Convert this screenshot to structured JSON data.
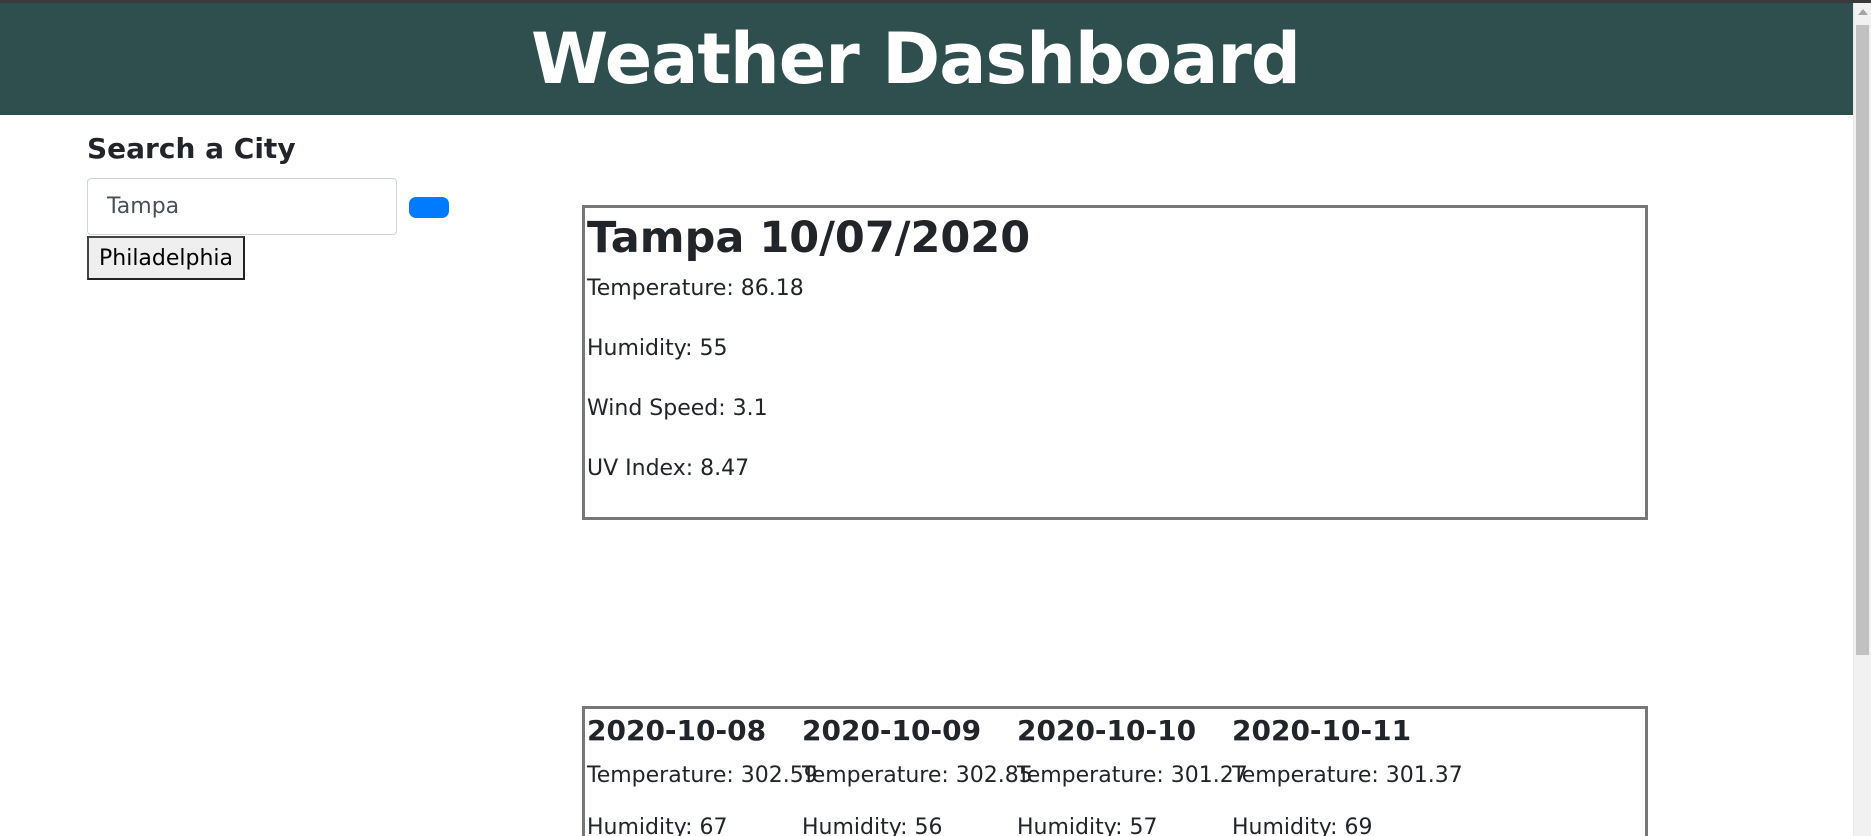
{
  "header": {
    "title": "Weather Dashboard"
  },
  "search": {
    "heading": "Search a City",
    "input_value": "Tampa",
    "button_label": "",
    "button_color": "#007bff",
    "history": [
      "Philadelphia"
    ]
  },
  "current": {
    "title": "Tampa 10/07/2020",
    "temperature": "Temperature: 86.18",
    "humidity": "Humidity: 55",
    "wind_speed": "Wind Speed: 3.1",
    "uv_index": "UV Index: 8.47"
  },
  "forecast": [
    {
      "date": "2020-10-08",
      "temperature": "Temperature: 302.59",
      "humidity": "Humidity: 67"
    },
    {
      "date": "2020-10-09",
      "temperature": "Temperature: 302.85",
      "humidity": "Humidity: 56"
    },
    {
      "date": "2020-10-10",
      "temperature": "Temperature: 301.27",
      "humidity": "Humidity: 57"
    },
    {
      "date": "2020-10-11",
      "temperature": "Temperature: 301.37",
      "humidity": "Humidity: 69"
    }
  ],
  "colors": {
    "header_bg": "#2f4f4f",
    "header_text": "#ffffff",
    "card_border": "#777777"
  },
  "icons": {
    "scroll_up": "triangle-up-icon"
  }
}
